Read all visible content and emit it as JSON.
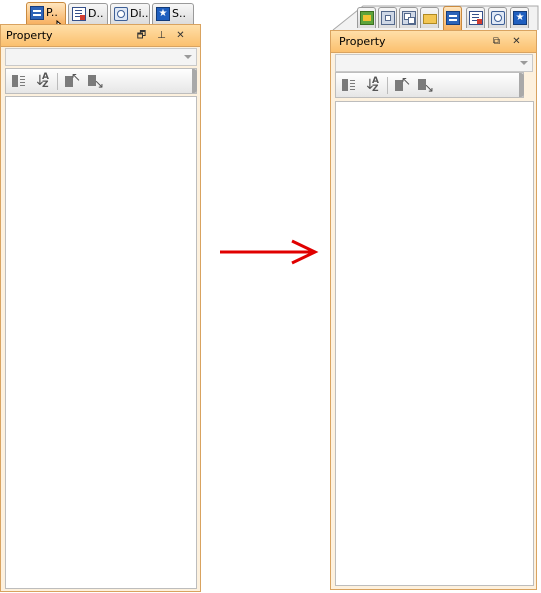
{
  "left_panel": {
    "tabs": [
      {
        "label": "P..",
        "icon": "property-icon",
        "active": true
      },
      {
        "label": "D..",
        "icon": "diagram-navigator-icon",
        "active": false
      },
      {
        "label": "Di..",
        "icon": "diagram-icon",
        "active": false
      },
      {
        "label": "S..",
        "icon": "star-icon",
        "active": false
      }
    ],
    "title": "Property",
    "buttons": {
      "restore": "🗗",
      "pin": "⊥",
      "close": "✕"
    }
  },
  "right_panel": {
    "tab_icons": [
      "model-explorer-icon",
      "document-icon",
      "copy-icon",
      "folder-icon",
      "property-icon",
      "diagram-navigator-icon",
      "diagram-icon",
      "star-icon"
    ],
    "title": "Property",
    "buttons": {
      "dock": "⧉",
      "close": "✕"
    }
  },
  "colors": {
    "accent": "#fbc06e",
    "border": "#d9a360",
    "arrow": "#e00000"
  }
}
